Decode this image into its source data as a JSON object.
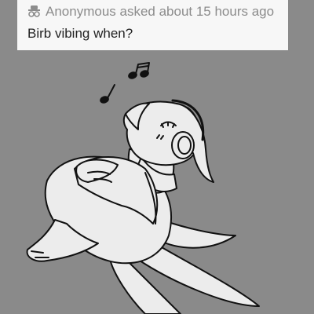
{
  "question": {
    "icon": "anonymous-icon",
    "asker_text": "Anonymous asked about 15 hours ago",
    "question_text": "Birb vibing when?"
  },
  "colors": {
    "background": "#8a8a8a",
    "card": "#f7f7f7",
    "meta_text": "#8c8c8c",
    "question_text": "#222222",
    "lineart": "#111111",
    "fill": "#ececec"
  }
}
